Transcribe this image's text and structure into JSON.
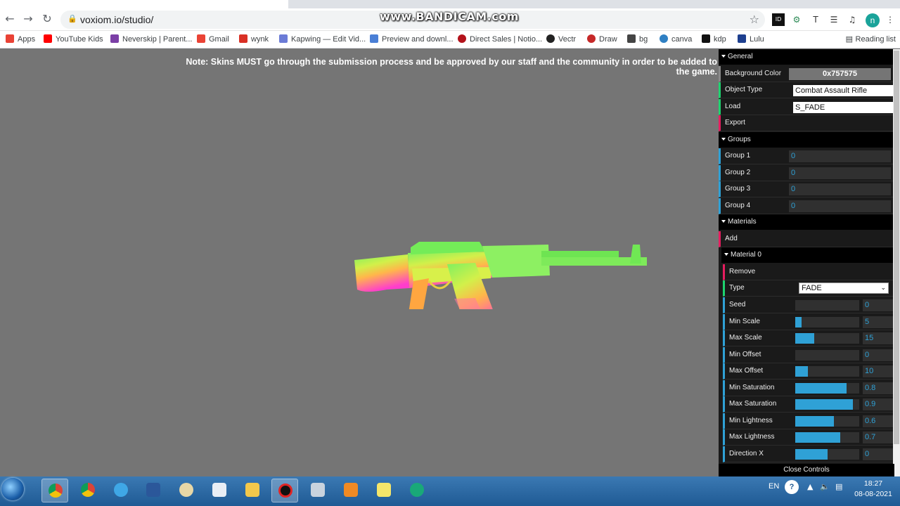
{
  "browser": {
    "url": "voxiom.io/studio/",
    "watermark": "www.BANDICAM.com",
    "avatar_letter": "n",
    "ext_letter_t": "T",
    "bookmarks": [
      {
        "label": "Apps",
        "color": "#e94235"
      },
      {
        "label": "YouTube Kids",
        "color": "#ff0000"
      },
      {
        "label": "Neverskip | Parent...",
        "color": "#7b3fa6"
      },
      {
        "label": "Gmail",
        "color": "#ea4335"
      },
      {
        "label": "wynk",
        "color": "#d93025"
      },
      {
        "label": "Kapwing — Edit Vid...",
        "color": "#6b7bd6"
      },
      {
        "label": "Preview and downl...",
        "color": "#4a7fd6"
      },
      {
        "label": "Direct Sales | Notio...",
        "color": "#b3121b"
      },
      {
        "label": "Vectr",
        "color": "#222222"
      },
      {
        "label": "Draw",
        "color": "#c62828"
      },
      {
        "label": "bg",
        "color": "#444444"
      },
      {
        "label": "canva",
        "color": "#2f80c3"
      },
      {
        "label": "kdp",
        "color": "#111111"
      },
      {
        "label": "Lulu",
        "color": "#1d3f8f"
      }
    ],
    "reading_list": "Reading list"
  },
  "viewport": {
    "background_color": "#757575",
    "note": "Note: Skins MUST go through the submission process and be approved by our staff and the community in order to be added to the game."
  },
  "controls": {
    "general": {
      "title": "General",
      "background_color_label": "Background Color",
      "background_color_value": "0x757575",
      "object_type_label": "Object Type",
      "object_type_value": "Combat Assault Rifle",
      "load_label": "Load",
      "load_value": "S_FADE",
      "export_label": "Export"
    },
    "groups": {
      "title": "Groups",
      "items": [
        {
          "label": "Group 1",
          "value": "0"
        },
        {
          "label": "Group 2",
          "value": "0"
        },
        {
          "label": "Group 3",
          "value": "0"
        },
        {
          "label": "Group 4",
          "value": "0"
        }
      ]
    },
    "materials": {
      "title": "Materials",
      "add_label": "Add",
      "material0": {
        "title": "Material 0",
        "remove_label": "Remove",
        "type_label": "Type",
        "type_value": "FADE",
        "sliders": [
          {
            "label": "Seed",
            "value": "0",
            "fill": 0.0
          },
          {
            "label": "Min Scale",
            "value": "5",
            "fill": 0.1
          },
          {
            "label": "Max Scale",
            "value": "15",
            "fill": 0.3
          },
          {
            "label": "Min Offset",
            "value": "0",
            "fill": 0.0
          },
          {
            "label": "Max Offset",
            "value": "10",
            "fill": 0.2
          },
          {
            "label": "Min Saturation",
            "value": "0.8",
            "fill": 0.8
          },
          {
            "label": "Max Saturation",
            "value": "0.9",
            "fill": 0.9
          },
          {
            "label": "Min Lightness",
            "value": "0.6",
            "fill": 0.6
          },
          {
            "label": "Max Lightness",
            "value": "0.7",
            "fill": 0.7
          },
          {
            "label": "Direction X",
            "value": "0",
            "fill": 0.5
          }
        ]
      }
    },
    "close_label": "Close Controls"
  },
  "taskbar": {
    "language": "EN",
    "time": "18:27",
    "date": "08-08-2021"
  }
}
